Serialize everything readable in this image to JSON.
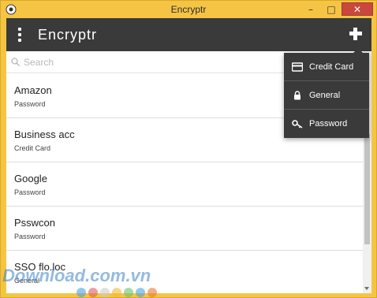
{
  "window": {
    "title": "Encryptr"
  },
  "appbar": {
    "title": "Encryptr"
  },
  "search": {
    "placeholder": "Search"
  },
  "entries": [
    {
      "name": "Amazon",
      "type": "Password"
    },
    {
      "name": "Business acc",
      "type": "Credit Card"
    },
    {
      "name": "Google",
      "type": "Password"
    },
    {
      "name": "Psswcon",
      "type": "Password"
    },
    {
      "name": "SSO flo.loc",
      "type": "General"
    }
  ],
  "new_entry_menu": [
    {
      "label": "Credit Card",
      "icon": "credit-card-icon"
    },
    {
      "label": "General",
      "icon": "lock-icon"
    },
    {
      "label": "Password",
      "icon": "key-icon"
    }
  ],
  "watermark": {
    "text": "Download.com.vn"
  },
  "colors": {
    "titlebar": "#f6c445",
    "appbar": "#3a3a3a",
    "dropdown": "#3a3a3a",
    "close": "#c9483d",
    "watermark_dots": [
      "#4aa3df",
      "#e05b5b",
      "#cccccc",
      "#f0b83c",
      "#6cc070",
      "#4aa3df",
      "#e87a3a"
    ]
  }
}
